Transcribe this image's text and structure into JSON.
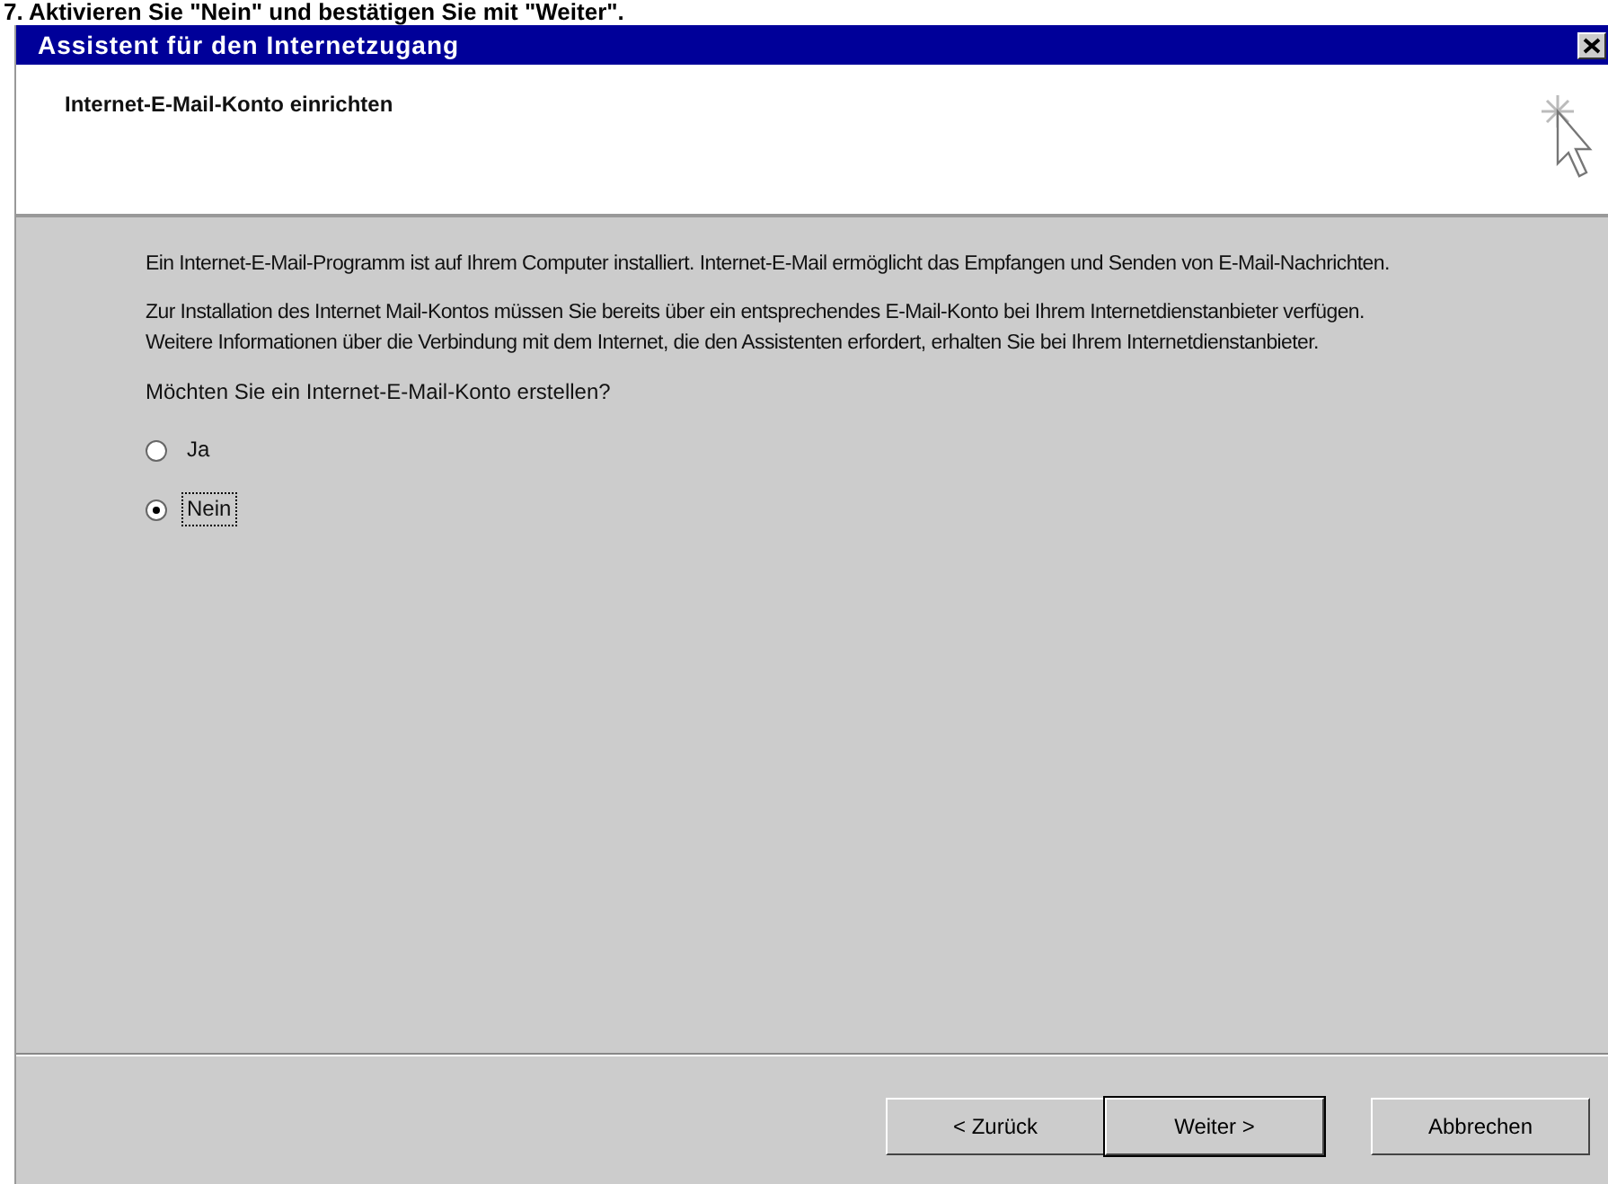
{
  "instruction": "7. Aktivieren Sie \"Nein\" und bestätigen Sie mit \"Weiter\".",
  "window": {
    "title": "Assistent für den Internetzugang"
  },
  "header": {
    "title": "Internet-E-Mail-Konto einrichten"
  },
  "paragraphs": [
    "Ein Internet-E-Mail-Programm ist auf Ihrem Computer installiert. Internet-E-Mail ermöglicht das Empfangen und Senden von E-Mail-Nachrichten.",
    "Zur Installation des Internet Mail-Kontos müssen Sie bereits über ein entsprechendes E-Mail-Konto bei Ihrem Internetdienstanbieter verfügen. Weitere Informationen über die Verbindung mit dem Internet, die den Assistenten erfordert, erhalten Sie bei Ihrem Internetdienstanbieter."
  ],
  "question": "Möchten Sie ein Internet-E-Mail-Konto erstellen?",
  "options": [
    {
      "label": "Ja",
      "selected": false
    },
    {
      "label": "Nein",
      "selected": true
    }
  ],
  "buttons": [
    {
      "label": "< Zurück",
      "default": false
    },
    {
      "label": "Weiter >",
      "default": true
    },
    {
      "label": "Abbrechen",
      "default": false
    }
  ]
}
